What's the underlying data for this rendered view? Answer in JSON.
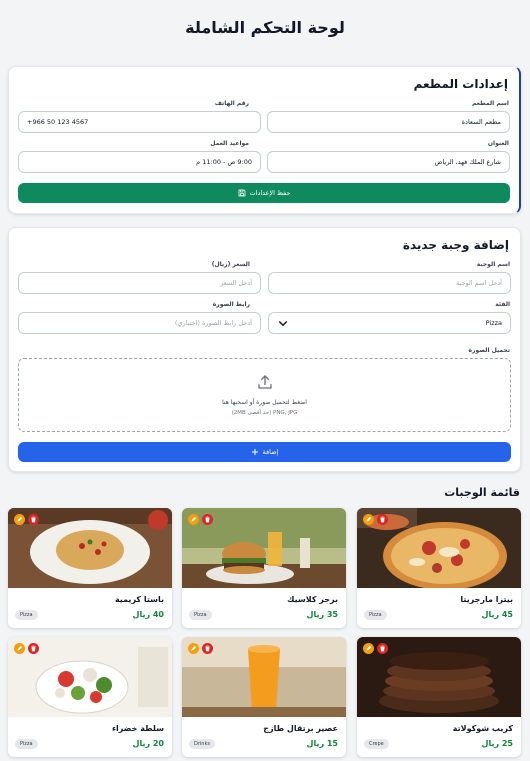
{
  "page": {
    "title": "لوحة التحكم الشاملة"
  },
  "settings": {
    "title": "إعدادات المطعم",
    "name_label": "اسم المطعم",
    "name_value": "مطعم السعادة",
    "phone_label": "رقم الهاتف",
    "phone_value": "+966 50 123 4567",
    "address_label": "العنوان",
    "address_value": "شارع الملك فهد، الرياض",
    "hours_label": "مواعيد العمل",
    "hours_value": "9:00 ص - 11:00 م",
    "save_label": "حفظ الإعدادات",
    "save_icon": "save-icon"
  },
  "add_meal": {
    "title": "إضافة وجبة جديدة",
    "name_label": "اسم الوجبة",
    "name_placeholder": "أدخل اسم الوجبة",
    "price_label": "السعر (ريال)",
    "price_placeholder": "أدخل السعر",
    "category_label": "الفئة",
    "category_value": "Pizza",
    "image_url_label": "رابط الصورة",
    "image_url_placeholder": "أدخل رابط الصورة (اختياري)",
    "upload_label": "تحميل الصورة",
    "upload_text": "اضغط لتحميل صورة أو اسحبها هنا",
    "upload_hint": "PNG, JPG (حد أقصى 2MB)",
    "add_label": "إضافة",
    "add_icon": "plus-icon"
  },
  "meals": {
    "title": "قائمة الوجبات",
    "items": [
      {
        "name": "بيتزا مارجريتا",
        "price": "45 ريال",
        "category": "Pizza",
        "image": "pizza-photo"
      },
      {
        "name": "برجر كلاسيك",
        "price": "35 ريال",
        "category": "Pizza",
        "image": "burger-photo"
      },
      {
        "name": "باستا كريمية",
        "price": "40 ريال",
        "category": "Pizza",
        "image": "pasta-photo"
      },
      {
        "name": "كريب شوكولاتة",
        "price": "25 ريال",
        "category": "Crepe",
        "image": "crepe-photo"
      },
      {
        "name": "عصير برتقال طازج",
        "price": "15 ريال",
        "category": "Drinks",
        "image": "orange-juice-photo"
      },
      {
        "name": "سلطة خضراء",
        "price": "20 ريال",
        "category": "Pizza",
        "image": "salad-photo"
      }
    ]
  },
  "colors": {
    "save_button": "#0f8a5f",
    "add_button": "#2563eb",
    "price_text": "#15803d",
    "delete_action": "#dc2626",
    "edit_action": "#f59e0b"
  }
}
